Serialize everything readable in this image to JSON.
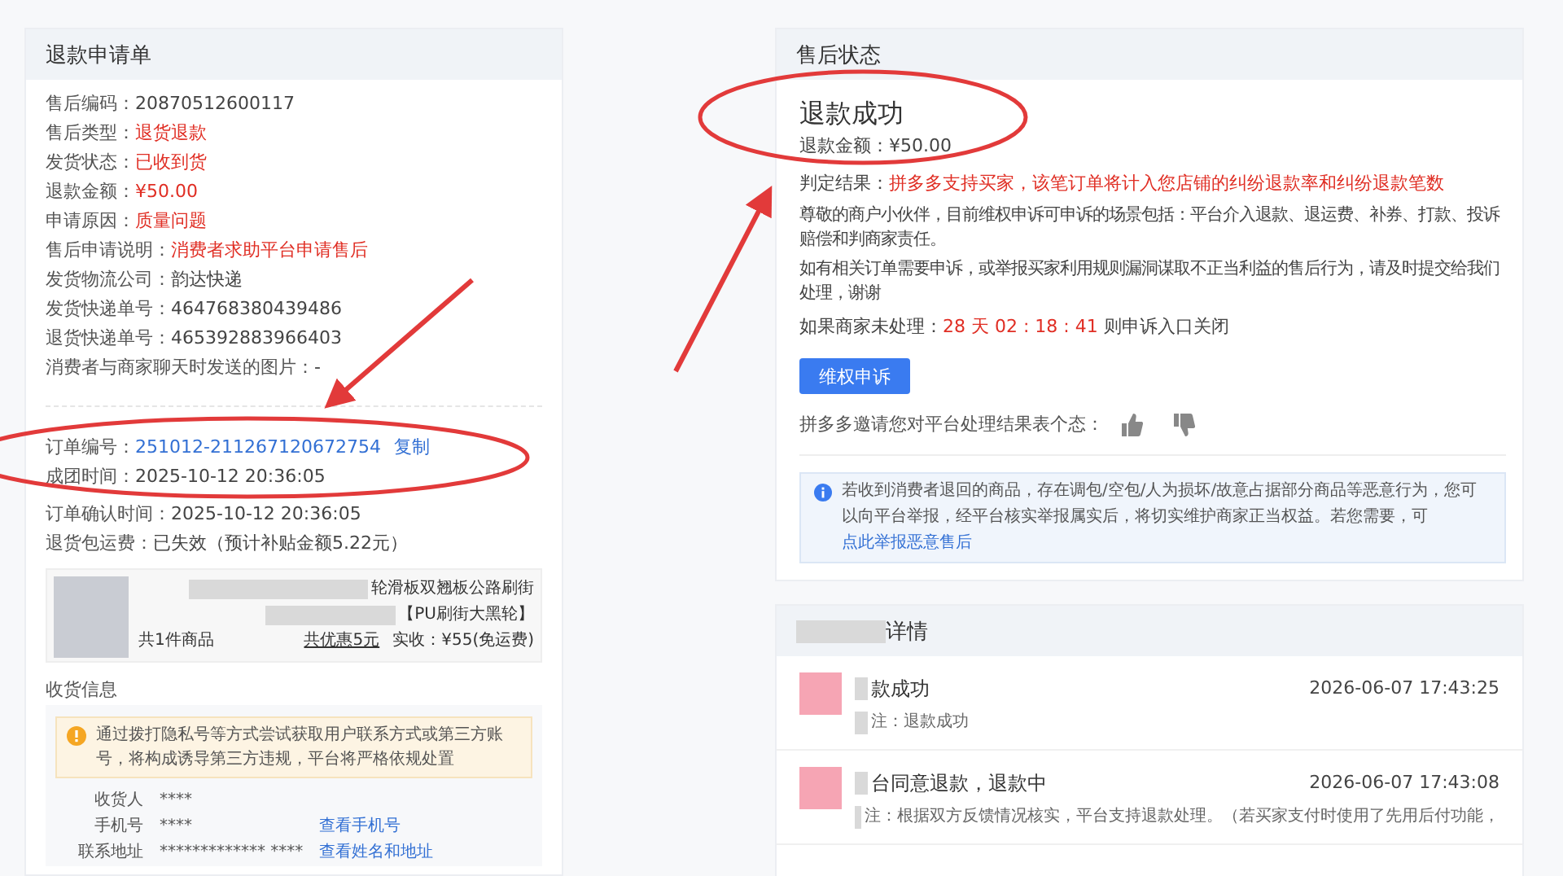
{
  "refund_form": {
    "title": "退款申请单",
    "fields": [
      {
        "label": "售后编码：",
        "value": "20870512600117",
        "highlight": false
      },
      {
        "label": "售后类型：",
        "value": "退货退款",
        "highlight": true
      },
      {
        "label": "发货状态：",
        "value": "已收到货",
        "highlight": true
      },
      {
        "label": "退款金额：",
        "value": "¥50.00",
        "highlight": true
      },
      {
        "label": "申请原因：",
        "value": "质量问题",
        "highlight": true
      },
      {
        "label": "售后申请说明：",
        "value": "消费者求助平台申请售后",
        "highlight": true
      },
      {
        "label": "发货物流公司：",
        "value": "韵达快递",
        "highlight": false
      },
      {
        "label": "发货快递单号：",
        "value": "464768380439486",
        "highlight": false
      },
      {
        "label": "退货快递单号：",
        "value": "465392883966403",
        "highlight": false
      },
      {
        "label": "消费者与商家聊天时发送的图片：",
        "value": "-",
        "highlight": false
      }
    ],
    "order_fields": [
      {
        "label": "订单编号：",
        "value": "251012-211267120672754",
        "link": "复制"
      },
      {
        "label": "成团时间：",
        "value": "2025-10-12 20:36:05"
      },
      {
        "label": "订单确认时间：",
        "value": "2025-10-12 20:36:05"
      },
      {
        "label": "退货包运费：",
        "value": "已失效（预计补贴金额5.22元）"
      }
    ],
    "product": {
      "title": "轮滑板双翘板公路刷街",
      "variant": "【PU刷街大黑轮】",
      "count": "共1件商品",
      "discount": "共优惠5元",
      "paid": "实收：¥55(免运费)"
    },
    "shipping": {
      "title": "收货信息",
      "warning": "通过拨打隐私号等方式尝试获取用户联系方式或第三方账号，将构成诱导第三方违规，平台将严格依规处置",
      "rows": [
        {
          "label": "收货人",
          "value": "****"
        },
        {
          "label": "手机号",
          "value": "****",
          "link": "查看手机号"
        },
        {
          "label": "联系地址",
          "value": "************* ****",
          "link": "查看姓名和地址"
        }
      ]
    }
  },
  "status_card": {
    "title": "售后状态",
    "status": "退款成功",
    "amount": "退款金额：¥50.00",
    "verdict_label": "判定结果：",
    "verdict": "拼多多支持买家，该笔订单将计入您店铺的纠纷退款率和纠纷退款笔数",
    "paragraphs": [
      "尊敬的商户小伙伴，目前维权申诉可申诉的场景包括：平台介入退款、退运费、补券、打款、投诉赔偿和判商家责任。",
      "如有相关订单需要申诉，或举报买家利用规则漏洞谋取不正当利益的售后行为，请及时提交给我们处理，谢谢"
    ],
    "countdown_label": "如果商家未处理：",
    "countdown": "28 天 02 : 18 : 41",
    "countdown_suffix": "则申诉入口关闭",
    "appeal_button": "维权申诉",
    "rating_prompt": "拼多多邀请您对平台处理结果表个态：",
    "info": "若收到消费者退回的商品，存在调包/空包/人为损坏/故意占据部分商品等恶意行为，您可以向平台举报，经平台核实举报属实后，将切实维护商家正当权益。若您需要，可",
    "info_link": "点此举报恶意售后"
  },
  "timeline_card": {
    "title": "详情",
    "entries": [
      {
        "title": "款成功",
        "time": "2026-06-07 17:43:25",
        "note": "注：退款成功"
      },
      {
        "title": "台同意退款，退款中",
        "time": "2026-06-07 17:43:08",
        "note": "注：根据双方反馈情况核实，平台支持退款处理。（若买家支付时使用了先用后付功能，"
      }
    ]
  }
}
